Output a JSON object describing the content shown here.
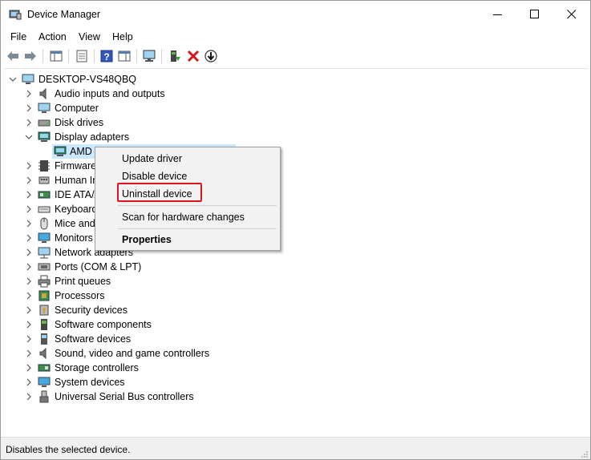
{
  "window": {
    "title": "Device Manager"
  },
  "menu": [
    "File",
    "Action",
    "View",
    "Help"
  ],
  "toolbar": [
    {
      "icon": "back-arrow-icon"
    },
    {
      "icon": "forward-arrow-icon"
    },
    {
      "icon": "show-hide-console-tree-icon"
    },
    {
      "icon": "properties-icon"
    },
    {
      "icon": "help-icon"
    },
    {
      "icon": "action-pane-icon"
    },
    {
      "icon": "scan-hardware-icon"
    },
    {
      "icon": "update-driver-icon"
    },
    {
      "icon": "uninstall-x-icon"
    },
    {
      "icon": "download-driver-icon"
    }
  ],
  "tree": {
    "root": "DESKTOP-VS48QBQ",
    "items": [
      {
        "label": "Audio inputs and outputs",
        "icon": "speaker-icon"
      },
      {
        "label": "Computer",
        "icon": "monitor-icon"
      },
      {
        "label": "Disk drives",
        "icon": "disk-drive-icon"
      },
      {
        "label": "Display adapters",
        "icon": "display-adapter-icon",
        "expanded": true
      },
      {
        "label": "AMD",
        "icon": "display-adapter-icon",
        "child": true,
        "selected": true
      },
      {
        "label": "Firmware",
        "icon": "firmware-icon"
      },
      {
        "label": "Human In",
        "icon": "hid-icon"
      },
      {
        "label": "IDE ATA/A",
        "icon": "ide-controller-icon"
      },
      {
        "label": "Keyboard",
        "icon": "keyboard-icon"
      },
      {
        "label": "Mice and",
        "icon": "mouse-icon"
      },
      {
        "label": "Monitors",
        "icon": "monitor-icon"
      },
      {
        "label": "Network adapters",
        "icon": "network-icon"
      },
      {
        "label": "Ports (COM & LPT)",
        "icon": "port-icon"
      },
      {
        "label": "Print queues",
        "icon": "printer-icon"
      },
      {
        "label": "Processors",
        "icon": "processor-icon"
      },
      {
        "label": "Security devices",
        "icon": "security-icon"
      },
      {
        "label": "Software components",
        "icon": "software-component-icon"
      },
      {
        "label": "Software devices",
        "icon": "software-device-icon"
      },
      {
        "label": "Sound, video and game controllers",
        "icon": "speaker-icon"
      },
      {
        "label": "Storage controllers",
        "icon": "storage-icon"
      },
      {
        "label": "System devices",
        "icon": "system-device-icon"
      },
      {
        "label": "Universal Serial Bus controllers",
        "icon": "usb-icon"
      }
    ]
  },
  "context_menu": {
    "update_driver": "Update driver",
    "disable_device": "Disable device",
    "uninstall_device": "Uninstall device",
    "scan": "Scan for hardware changes",
    "properties": "Properties"
  },
  "status": "Disables the selected device.",
  "colors": {
    "highlight": "#e0141e",
    "selection": "#cce8ff"
  }
}
